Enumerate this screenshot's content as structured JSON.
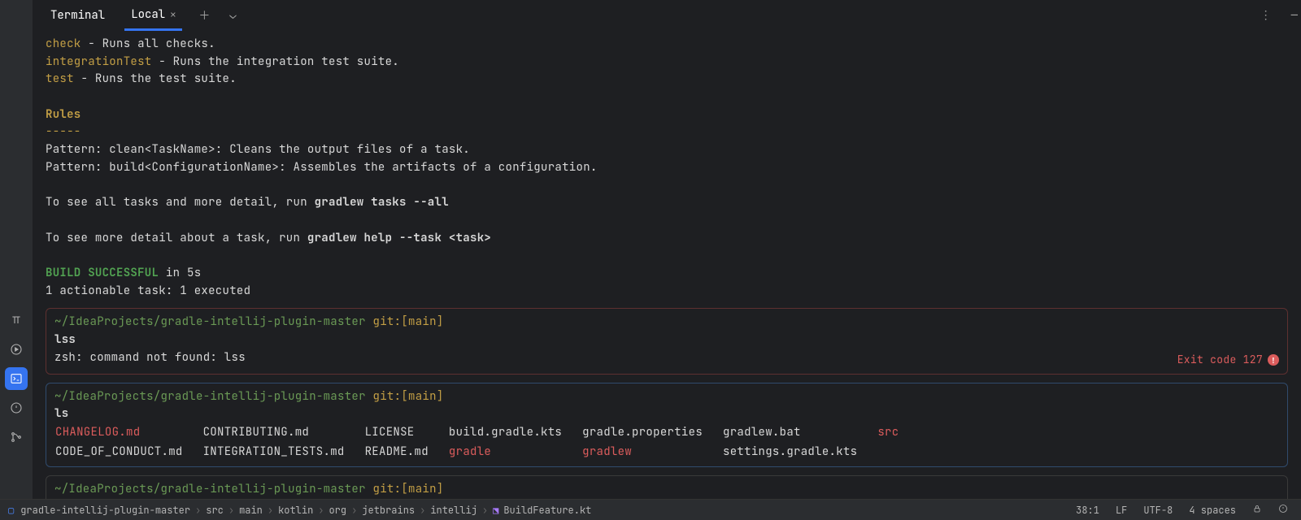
{
  "tabs": {
    "primary": "Terminal",
    "secondary": "Local"
  },
  "term": {
    "tasks": [
      {
        "name": "check",
        "desc": " - Runs all checks."
      },
      {
        "name": "integrationTest",
        "desc": " - Runs the integration test suite."
      },
      {
        "name": "test",
        "desc": " - Runs the test suite."
      }
    ],
    "rules_head": "Rules",
    "rules_dash": "-----",
    "rules": [
      "Pattern: clean<TaskName>: Cleans the output files of a task.",
      "Pattern: build<ConfigurationName>: Assembles the artifacts of a configuration."
    ],
    "hint1_pre": "To see all tasks and more detail, run ",
    "hint1_bold": "gradlew tasks --all",
    "hint2_pre": "To see more detail about a task, run ",
    "hint2_bold": "gradlew help --task <task>",
    "build_ok": "BUILD SUCCESSFUL",
    "build_time": " in 5s",
    "build_line": "1 actionable task: 1 executed",
    "prompt_path": "~/IdeaProjects/gradle-intellij-plugin-master",
    "prompt_git": " git:",
    "prompt_br": "[main]",
    "err_cmd": "lss",
    "err_msg": "zsh: command not found: lss",
    "err_exit": "Exit code 127",
    "ls_cmd": "ls",
    "ls": {
      "r0": {
        "c0": "CHANGELOG.md",
        "c1": "CONTRIBUTING.md",
        "c2": "LICENSE",
        "c3": "build.gradle.kts",
        "c4": "gradle.properties",
        "c5": "gradlew.bat",
        "c6": "src"
      },
      "r1": {
        "c0": "CODE_OF_CONDUCT.md",
        "c1": "INTEGRATION_TESTS.md",
        "c2": "README.md",
        "c3": "gradle",
        "c4": "gradlew",
        "c5": "settings.gradle.kts",
        "c6": ""
      }
    }
  },
  "status": {
    "crumbs": [
      "gradle-intellij-plugin-master",
      "src",
      "main",
      "kotlin",
      "org",
      "jetbrains",
      "intellij",
      "BuildFeature.kt"
    ],
    "pos": "38:1",
    "eol": "LF",
    "enc": "UTF-8",
    "indent": "4 spaces"
  }
}
